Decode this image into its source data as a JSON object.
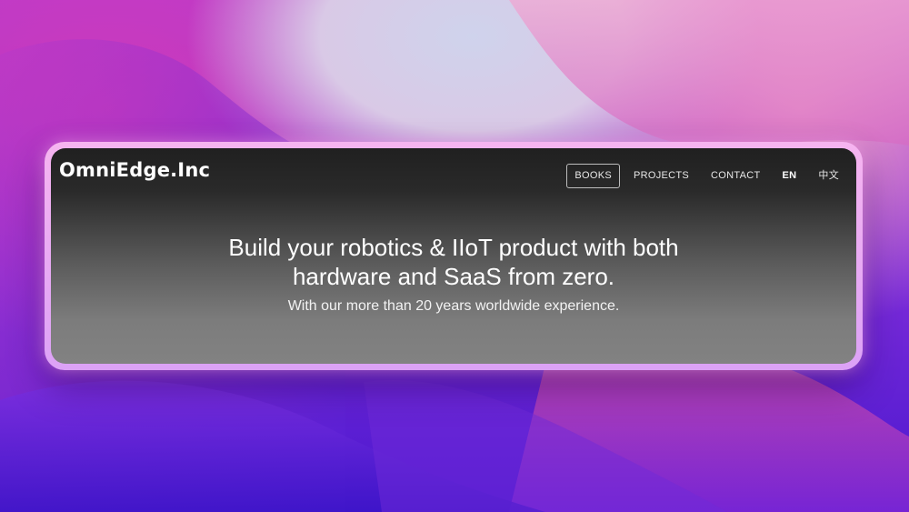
{
  "brand": {
    "name": "OmniEdge.Inc"
  },
  "nav": {
    "items": [
      {
        "label": "BOOKS",
        "active": true
      },
      {
        "label": "PROJECTS",
        "active": false
      },
      {
        "label": "CONTACT",
        "active": false
      },
      {
        "label": "EN",
        "active": false
      },
      {
        "label": "中文",
        "active": false
      }
    ]
  },
  "hero": {
    "title_line1": "Build your robotics & IIoT product with both",
    "title_line2": "hardware and SaaS from zero.",
    "subtitle": "With our more than 20 years worldwide experience."
  },
  "colors": {
    "frame_border": "#f3b0f0",
    "screen_top": "#202020",
    "screen_bottom": "#828282",
    "text": "#ffffff",
    "wallpaper_purple": "#5b1fd6",
    "wallpaper_pink": "#d23ab8"
  }
}
